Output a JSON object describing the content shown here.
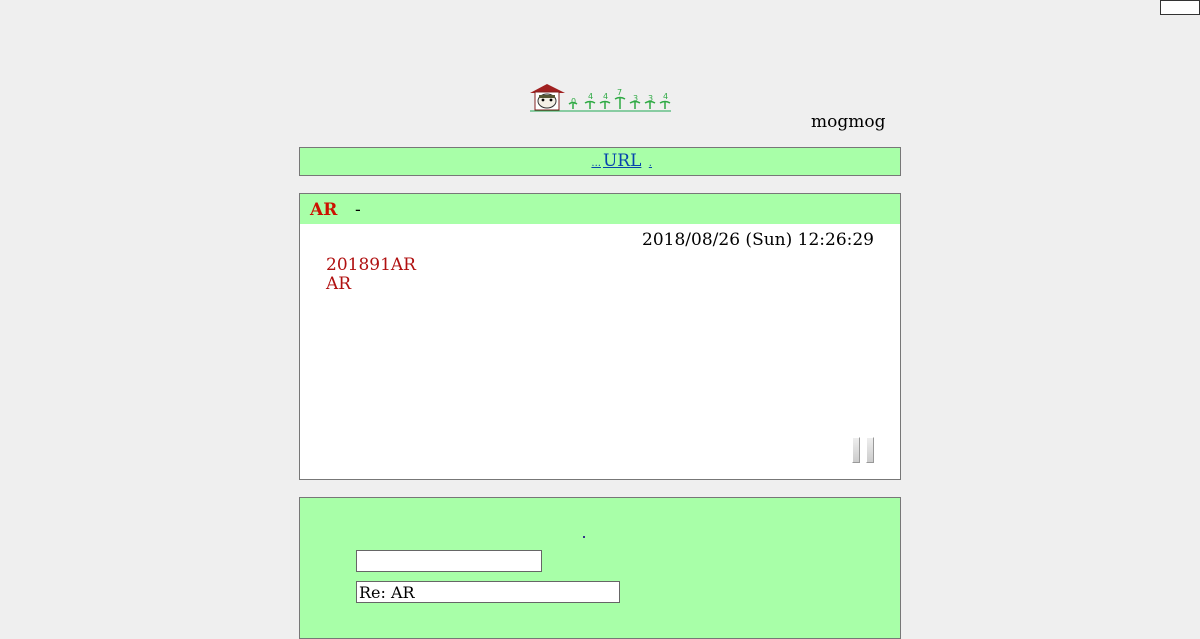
{
  "header": {
    "logo_icon": "house-mascot-sprout-logo",
    "site_owner": "mogmog"
  },
  "nav": {
    "blank_link_label": "",
    "dots": "...",
    "url_link_label": "URL",
    "trailing_dot": "."
  },
  "post": {
    "title": "AR",
    "author_separator": "-",
    "date": "2018/08/26 (Sun) 12:26:29",
    "body_lines": [
      "201891AR",
      "AR"
    ]
  },
  "reply": {
    "name_value": "",
    "subject_value": "Re: AR"
  },
  "colors": {
    "page_bg": "#efefef",
    "panel_green": "#a8ffa8",
    "title_red": "#cc1100",
    "body_red": "#b01010",
    "link_blue": "#0645ad"
  }
}
